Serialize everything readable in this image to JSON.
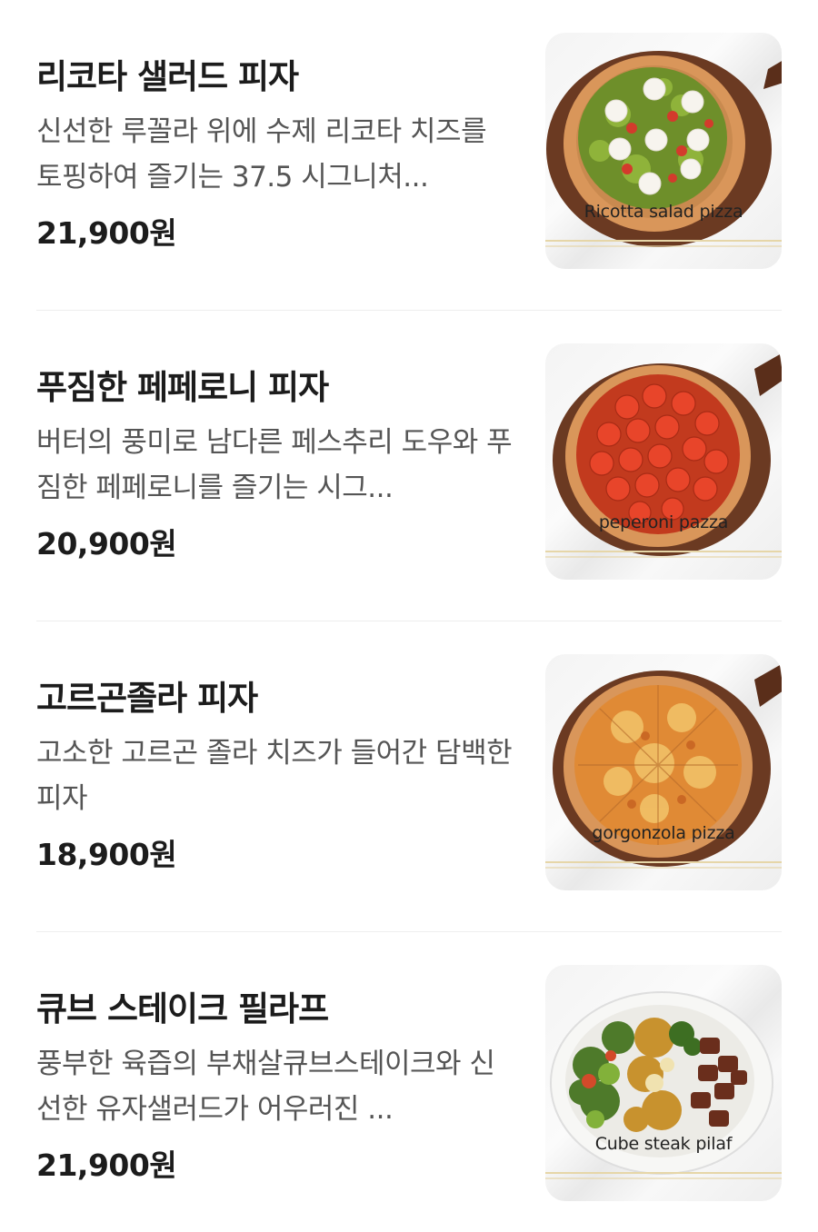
{
  "menu": {
    "items": [
      {
        "name": "리코타 샐러드 피자",
        "description": "신선한 루꼴라 위에 수제 리코타 치즈를 토핑하여 즐기는 37.5 시그니처...",
        "price": "21,900원",
        "image_caption": "Ricotta salad pizza",
        "image_icon": "ricotta-salad-pizza-image"
      },
      {
        "name": "푸짐한 페페로니 피자",
        "description": "버터의 풍미로 남다른 페스추리 도우와 푸짐한 페페로니를 즐기는 시그...",
        "price": "20,900원",
        "image_caption": "peperoni pazza",
        "image_icon": "pepperoni-pizza-image"
      },
      {
        "name": "고르곤졸라 피자",
        "description": "고소한 고르곤 졸라 치즈가 들어간 담백한 피자",
        "price": "18,900원",
        "image_caption": "gorgonzola pizza",
        "image_icon": "gorgonzola-pizza-image"
      },
      {
        "name": "큐브 스테이크 필라프",
        "description": "풍부한 육즙의 부채살큐브스테이크와 신선한 유자샐러드가 어우러진 ...",
        "price": "21,900원",
        "image_caption": "Cube steak pilaf",
        "image_icon": "cube-steak-pilaf-image"
      }
    ]
  }
}
